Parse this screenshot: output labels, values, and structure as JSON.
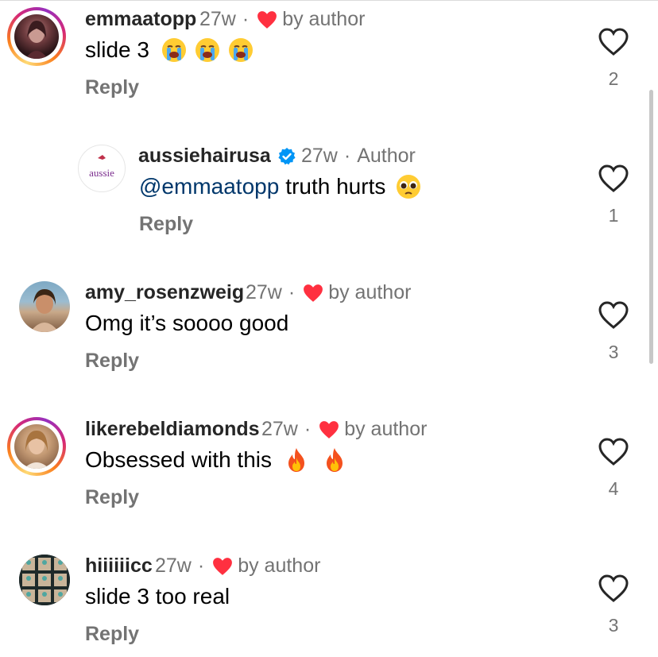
{
  "comments": [
    {
      "username": "emmaatopp",
      "time": "27w",
      "sep": "·",
      "liked_label": "by author",
      "text": "slide 3",
      "reply": "Reply",
      "likes": "2",
      "emojis": [
        "loudly-crying-face",
        "loudly-crying-face",
        "loudly-crying-face"
      ]
    },
    {
      "username": "aussiehairusa",
      "time": "27w",
      "sep": "·",
      "role": "Author",
      "avatar_text": "aussie",
      "mention": "@emmaatopp",
      "text": "truth hurts",
      "reply": "Reply",
      "likes": "1",
      "emojis": [
        "pleading-face"
      ]
    },
    {
      "username": "amy_rosenzweig",
      "time": "27w",
      "sep": "·",
      "liked_label": "by author",
      "text": "Omg it’s soooo good",
      "reply": "Reply",
      "likes": "3"
    },
    {
      "username": "likerebeldiamonds",
      "time": "27w",
      "sep": "·",
      "liked_label": "by author",
      "text": "Obsessed with this",
      "reply": "Reply",
      "likes": "4",
      "emojis": [
        "fire",
        "fire"
      ]
    },
    {
      "username": "hiiiiiicc",
      "time": "27w",
      "sep": "·",
      "liked_label": "by author",
      "text": "slide 3 too real",
      "reply": "Reply",
      "likes": "3"
    }
  ],
  "colors": {
    "heart_red": "#ff3040",
    "verified_blue": "#0095f6",
    "mention_blue": "#00376b",
    "muted_gray": "#737373",
    "aussie_purple": "#7b2d8e"
  }
}
